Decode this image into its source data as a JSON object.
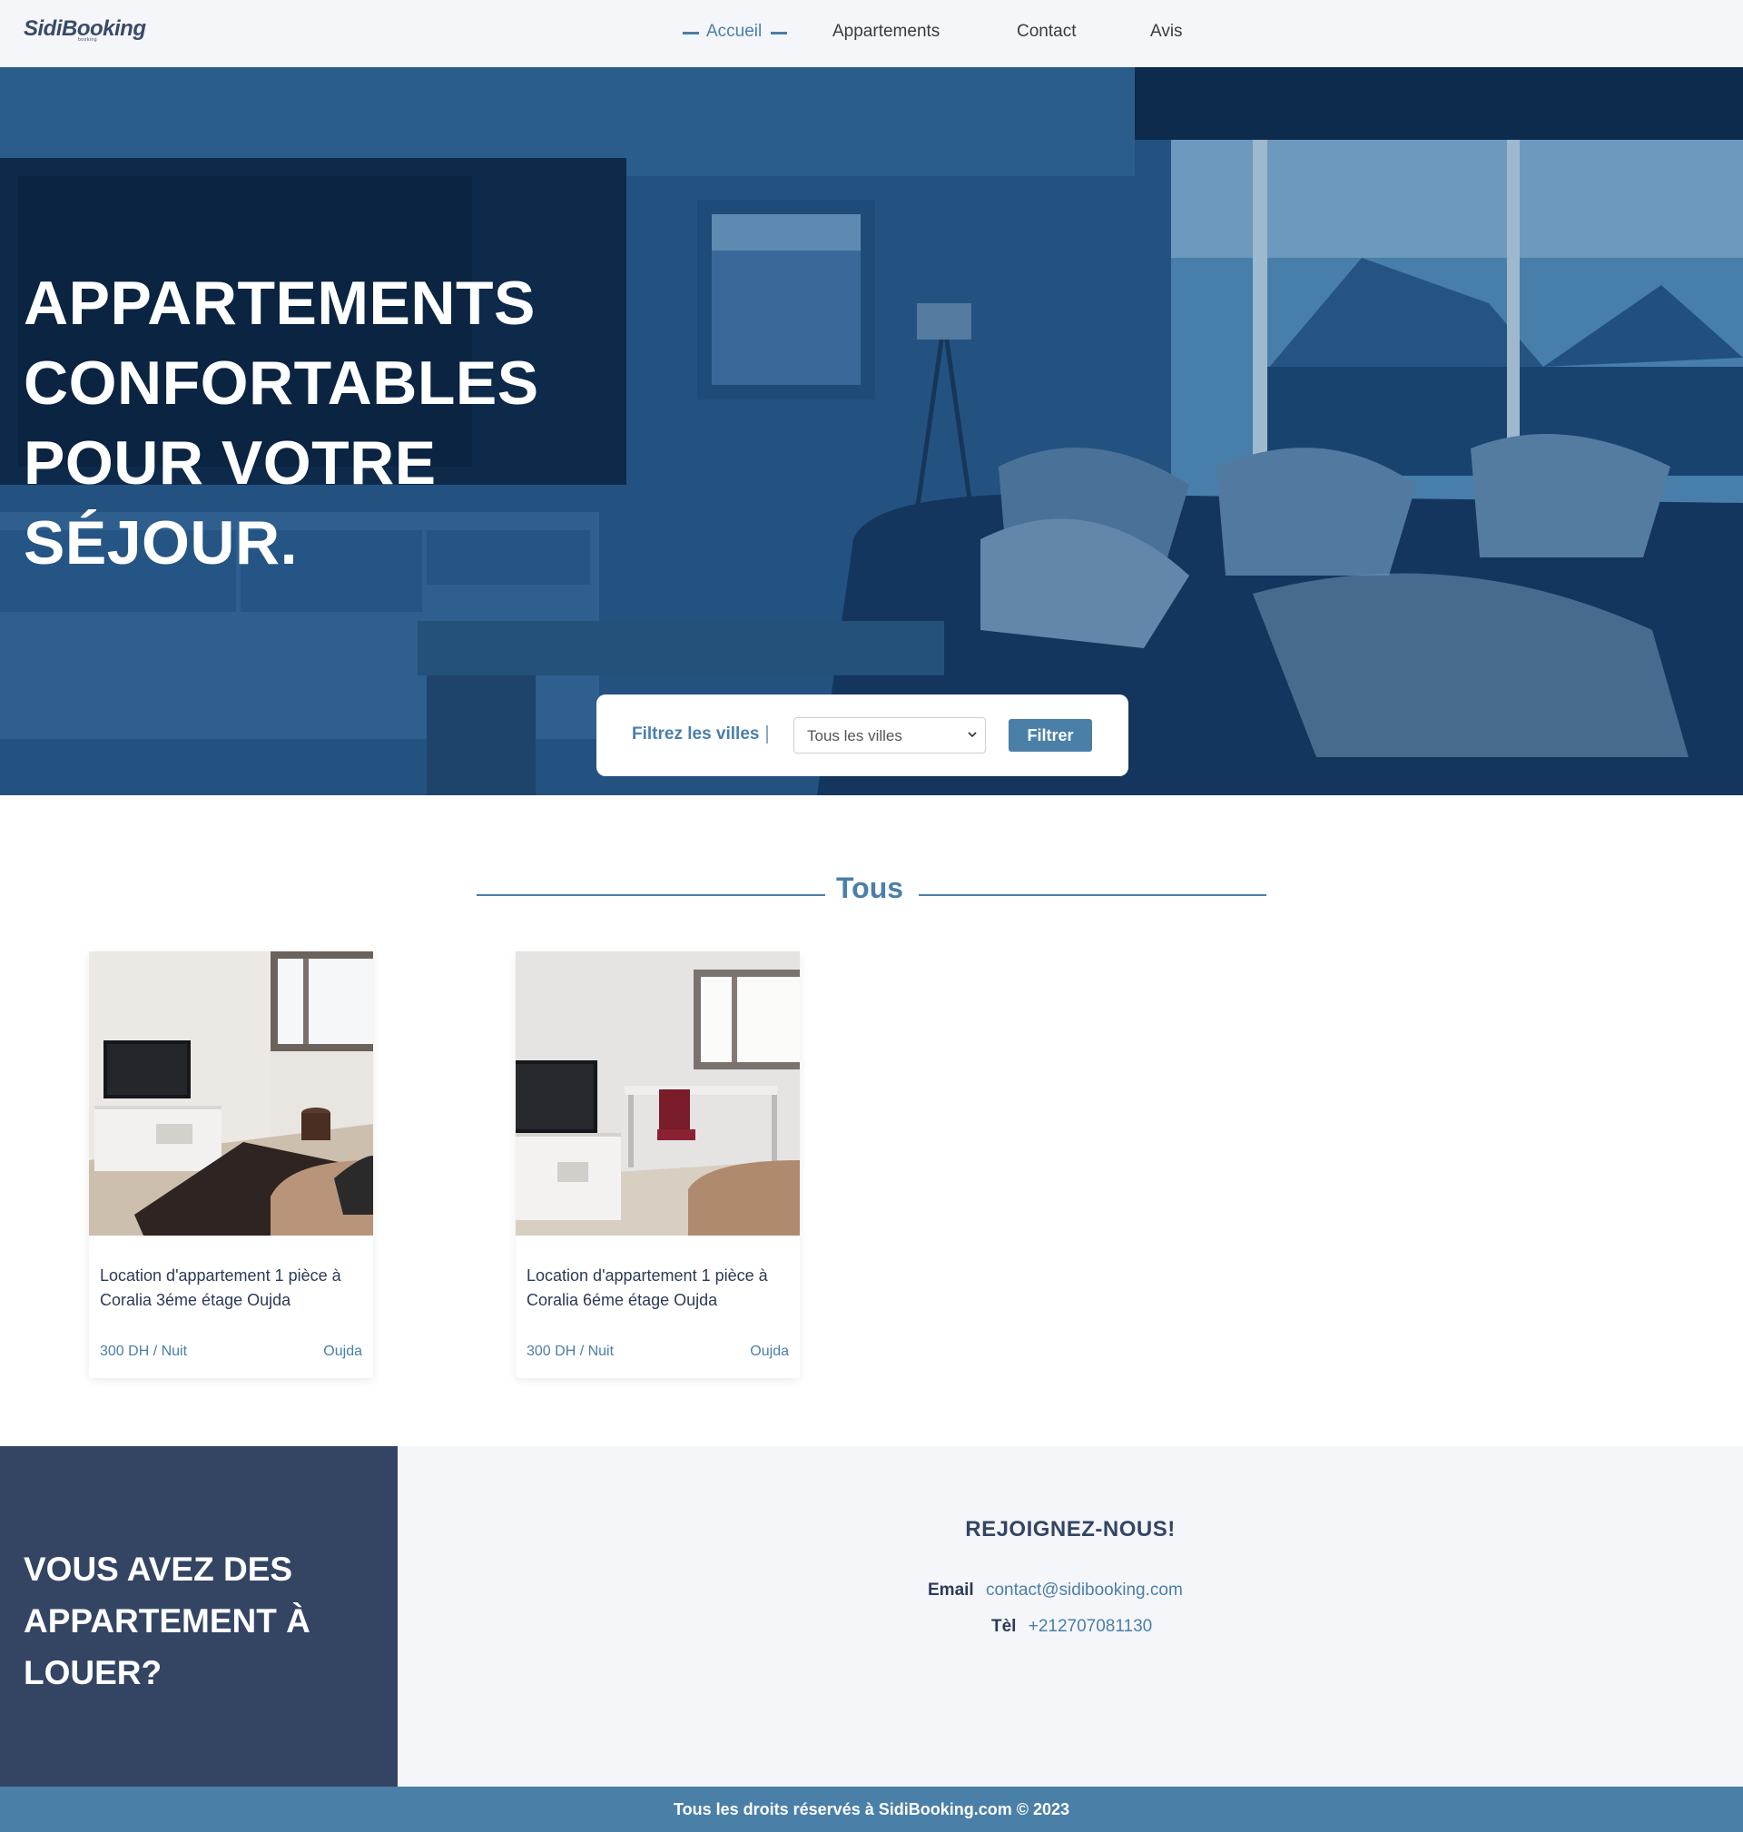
{
  "brand": {
    "logo_text": "SidiBooking",
    "logo_sub": "booking"
  },
  "nav": {
    "items": [
      {
        "label": "Accueil",
        "active": true
      },
      {
        "label": "Appartements",
        "active": false
      },
      {
        "label": "Contact",
        "active": false
      },
      {
        "label": "Avis",
        "active": false
      }
    ]
  },
  "hero": {
    "title_lines": [
      "APPARTEMENTS",
      "CONFORTABLES",
      "POUR VOTRE",
      "SÉJOUR."
    ]
  },
  "filter": {
    "label": "Filtrez les villes",
    "select_value": "Tous les villes",
    "button_label": "Filtrer"
  },
  "section": {
    "title": "Tous"
  },
  "listings": [
    {
      "title": "Location d'appartement 1 pièce à Coralia 3éme étage Oujda",
      "price": "300 DH / Nuit",
      "city": "Oujda"
    },
    {
      "title": "Location d'appartement 1 pièce à Coralia 6éme étage Oujda",
      "price": "300 DH / Nuit",
      "city": "Oujda"
    }
  ],
  "cta": {
    "title": "VOUS AVEZ DES APPARTEMENT À LOUER?"
  },
  "join": {
    "title": "REJOIGNEZ-NOUS!",
    "email_label": "Email",
    "email_value": "contact@sidibooking.com",
    "tel_label": "Tèl",
    "tel_value": "+212707081130"
  },
  "footer": {
    "copyright": "Tous les droits réservés à SidiBooking.com © 2023"
  },
  "colors": {
    "accent": "#4a7fa8",
    "dark": "#344564",
    "light_bg": "#f5f6fa"
  }
}
